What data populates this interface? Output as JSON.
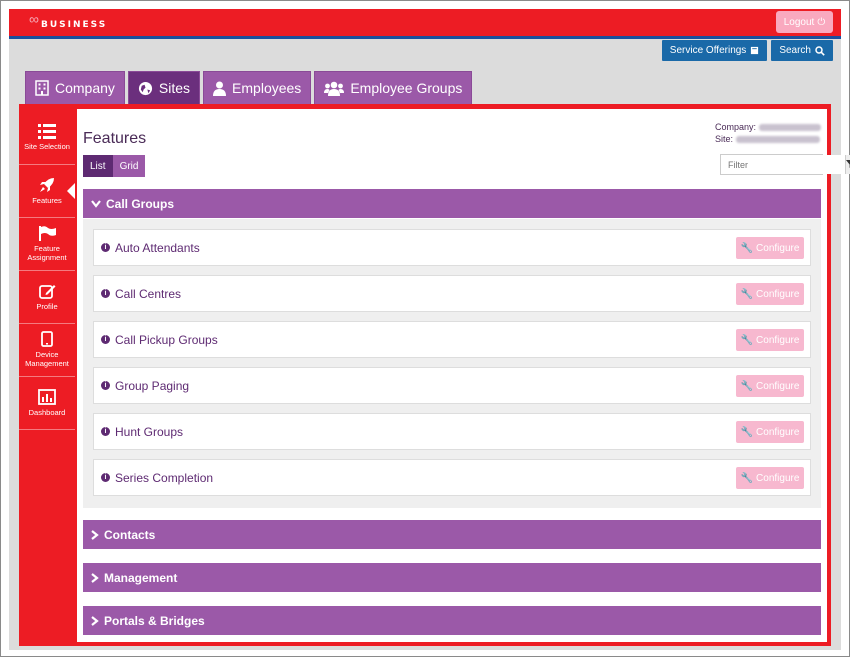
{
  "header": {
    "brand": "BUSINESS",
    "logout_label": "Logout",
    "service_offerings_label": "Service Offerings",
    "search_label": "Search"
  },
  "tabs": [
    {
      "label": "Company",
      "icon": "building-icon",
      "active": false
    },
    {
      "label": "Sites",
      "icon": "globe-icon",
      "active": true
    },
    {
      "label": "Employees",
      "icon": "user-icon",
      "active": false
    },
    {
      "label": "Employee Groups",
      "icon": "users-icon",
      "active": false
    }
  ],
  "sidebar": {
    "items": [
      {
        "label": "Site Selection",
        "icon": "list-icon"
      },
      {
        "label": "Features",
        "icon": "rocket-icon",
        "active": true
      },
      {
        "label": "Feature Assignment",
        "icon": "flag-icon"
      },
      {
        "label": "Profile",
        "icon": "edit-icon"
      },
      {
        "label": "Device Management",
        "icon": "tablet-icon"
      },
      {
        "label": "Dashboard",
        "icon": "bar-chart-icon"
      }
    ]
  },
  "content": {
    "title": "Features",
    "view_list": "List",
    "view_grid": "Grid",
    "company_label": "Company:",
    "site_label": "Site:",
    "filter_placeholder": "Filter"
  },
  "sections": [
    {
      "label": "Call Groups",
      "expanded": true
    },
    {
      "label": "Contacts",
      "expanded": false
    },
    {
      "label": "Management",
      "expanded": false
    },
    {
      "label": "Portals & Bridges",
      "expanded": false
    }
  ],
  "features": [
    {
      "label": "Auto Attendants",
      "button": "Configure"
    },
    {
      "label": "Call Centres",
      "button": "Configure"
    },
    {
      "label": "Call Pickup Groups",
      "button": "Configure"
    },
    {
      "label": "Group Paging",
      "button": "Configure"
    },
    {
      "label": "Hunt Groups",
      "button": "Configure"
    },
    {
      "label": "Series Completion",
      "button": "Configure"
    }
  ],
  "colors": {
    "brand_red": "#ed1c24",
    "purple": "#9b59a8",
    "purple_dark": "#5e2a72",
    "pink_disabled": "#f7b8cf",
    "action_blue": "#1a69a8"
  }
}
